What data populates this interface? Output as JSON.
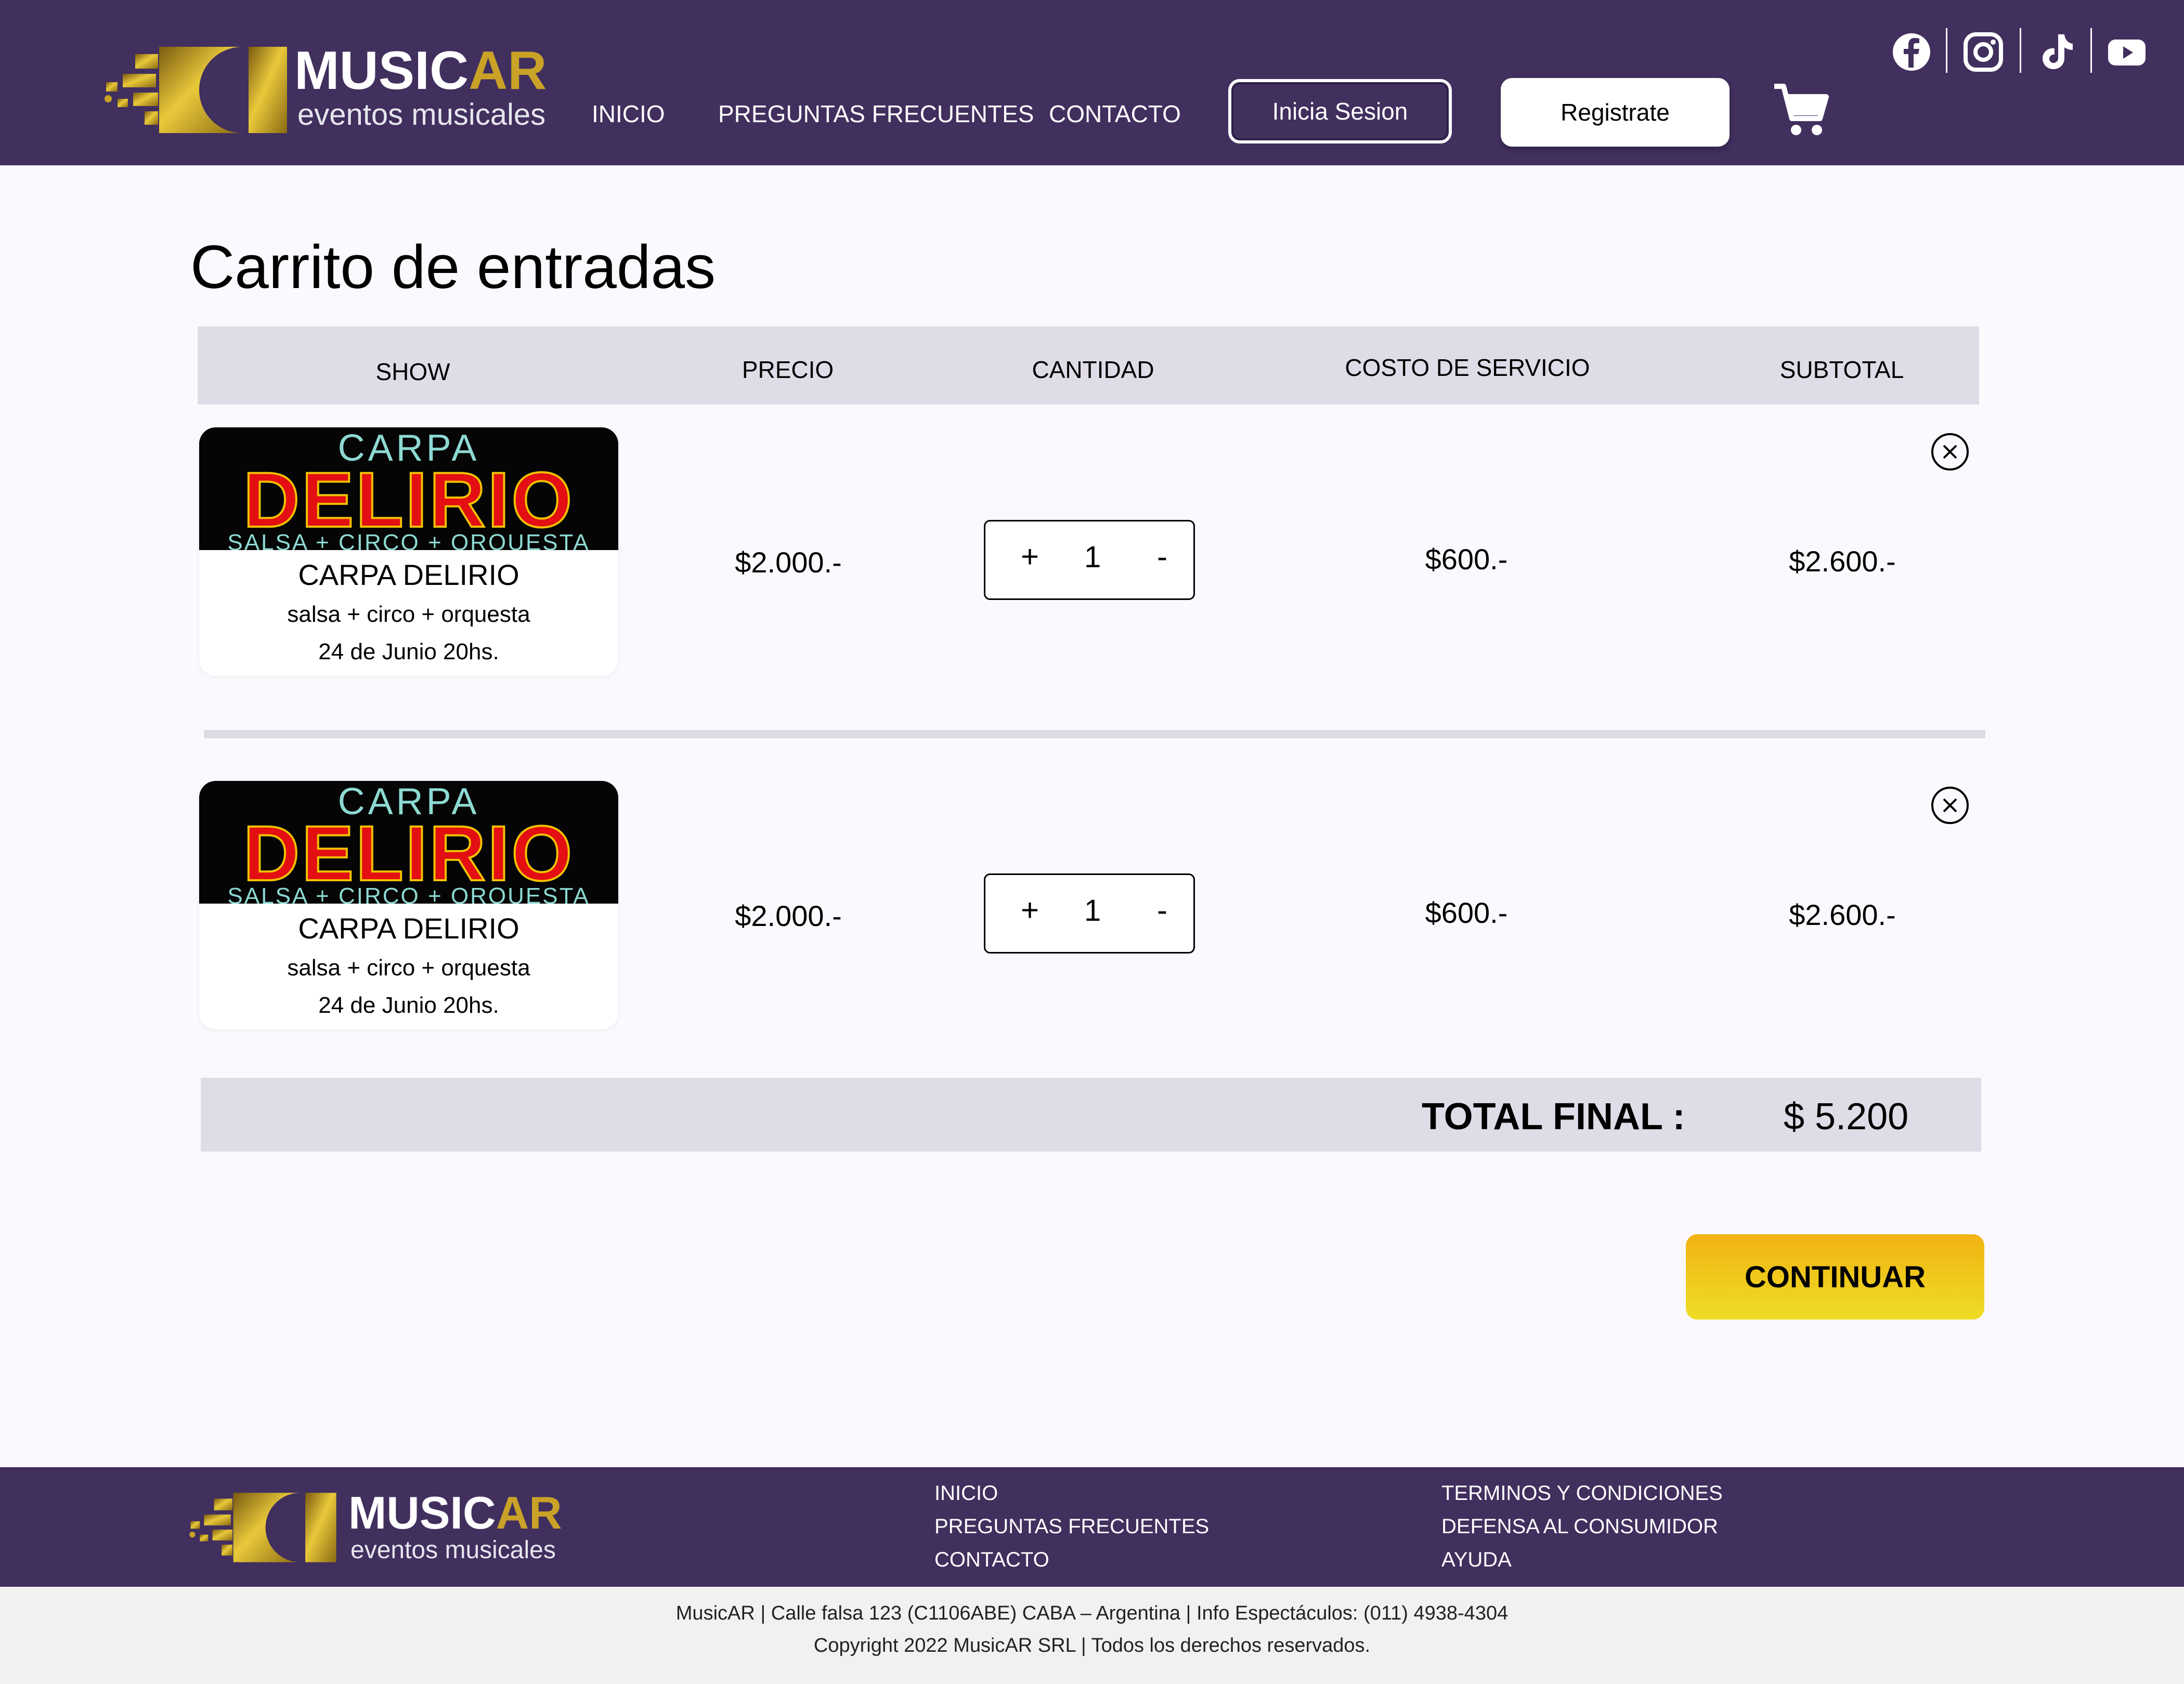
{
  "header": {
    "brand_main": "MUSIC",
    "brand_accent": "AR",
    "brand_tagline": "eventos musicales",
    "nav": [
      {
        "label": "INICIO"
      },
      {
        "label": "PREGUNTAS FRECUENTES"
      },
      {
        "label": "CONTACTO"
      }
    ],
    "login_label": "Inicia Sesion",
    "register_label": "Registrate",
    "cart_icon": "shopping-cart-icon",
    "social_icons": [
      "facebook-icon",
      "instagram-icon",
      "tiktok-icon",
      "youtube-icon"
    ]
  },
  "cart": {
    "title": "Carrito de entradas",
    "columns": [
      "SHOW",
      "PRECIO",
      "CANTIDAD",
      "COSTO DE SERVICIO",
      "SUBTOTAL"
    ],
    "items": [
      {
        "poster_top": "CARPA",
        "poster_main": "DELIRIO",
        "poster_bottom": "SALSA + CIRCO + ORQUESTA",
        "show_name": "CARPA DELIRIO",
        "description": "salsa + circo + orquesta",
        "date": "24 de Junio 20hs.",
        "price": "$2.000.-",
        "plus": "+",
        "quantity": "1",
        "minus": "-",
        "service_cost": "$600.-",
        "subtotal": "$2.600.-"
      },
      {
        "poster_top": "CARPA",
        "poster_main": "DELIRIO",
        "poster_bottom": "SALSA + CIRCO + ORQUESTA",
        "show_name": "CARPA DELIRIO",
        "description": "salsa + circo + orquesta",
        "date": "24 de Junio 20hs.",
        "price": "$2.000.-",
        "plus": "+",
        "quantity": "1",
        "minus": "-",
        "service_cost": "$600.-",
        "subtotal": "$2.600.-"
      }
    ],
    "total_label": "TOTAL FINAL :",
    "total_value": "$ 5.200",
    "continue_label": "CONTINUAR"
  },
  "footer": {
    "brand_main": "MUSIC",
    "brand_accent": "AR",
    "brand_tagline": "eventos musicales",
    "links_left": [
      "INICIO",
      "PREGUNTAS FRECUENTES",
      "CONTACTO"
    ],
    "links_right": [
      "TERMINOS Y CONDICIONES",
      "DEFENSA AL CONSUMIDOR",
      "AYUDA"
    ],
    "info_line": "MusicAR | Calle falsa 123 (C1106ABE) CABA – Argentina | Info Espectáculos: (011) 4938-4304",
    "copyright": "Copyright 2022 MusicAR SRL | Todos los derechos reservados."
  },
  "colors": {
    "header_bg": "#412f5e",
    "table_header_bg": "#e0dce7",
    "brand_gold": "#c9a227",
    "continue_button": "#f2c31a",
    "poster_red": "#e30f12",
    "page_bg": "#fbf9fd"
  }
}
